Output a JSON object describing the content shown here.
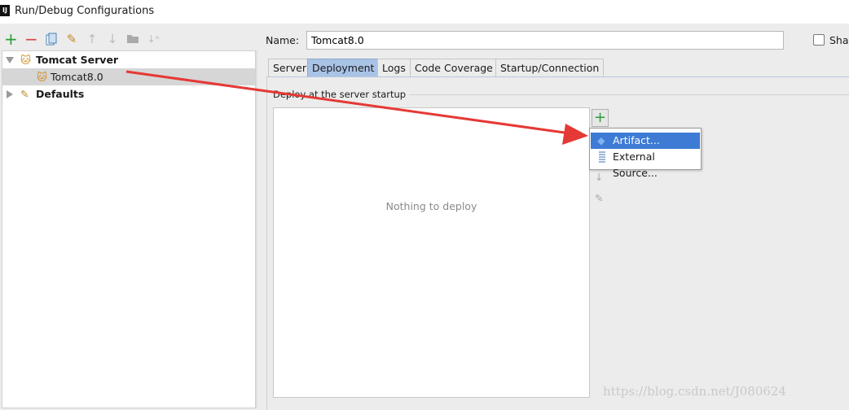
{
  "window": {
    "title": "Run/Debug Configurations",
    "app_icon": "IJ"
  },
  "toolbar": {
    "icons": [
      "add-icon",
      "remove-icon",
      "copy-icon",
      "wrench-icon",
      "move-up-icon",
      "move-down-icon",
      "folder-icon",
      "sort-icon"
    ]
  },
  "tree": [
    {
      "label": "Tomcat Server",
      "expanded": true,
      "bold": true
    },
    {
      "label": "Tomcat8.0",
      "selected": true
    },
    {
      "label": "Defaults",
      "expanded": false,
      "bold": true
    }
  ],
  "name": {
    "label": "Name:",
    "value": "Tomcat8.0"
  },
  "share": {
    "label": "Shar",
    "checked": false
  },
  "tabs": [
    {
      "label": "Server"
    },
    {
      "label": "Deployment",
      "active": true
    },
    {
      "label": "Logs"
    },
    {
      "label": "Code Coverage"
    },
    {
      "label": "Startup/Connection"
    }
  ],
  "deployment": {
    "group_title": "Deploy at the server startup",
    "empty_text": "Nothing to deploy"
  },
  "add_menu": {
    "items": [
      {
        "label": "Artifact...",
        "highlighted": true
      },
      {
        "label": "External Source..."
      }
    ]
  },
  "colors": {
    "selection": "#3d7bd5",
    "active_tab": "#a9c3e6",
    "arrow": "#e53935",
    "add": "#2a9d3a"
  },
  "watermark": "https://blog.csdn.net/J080624"
}
